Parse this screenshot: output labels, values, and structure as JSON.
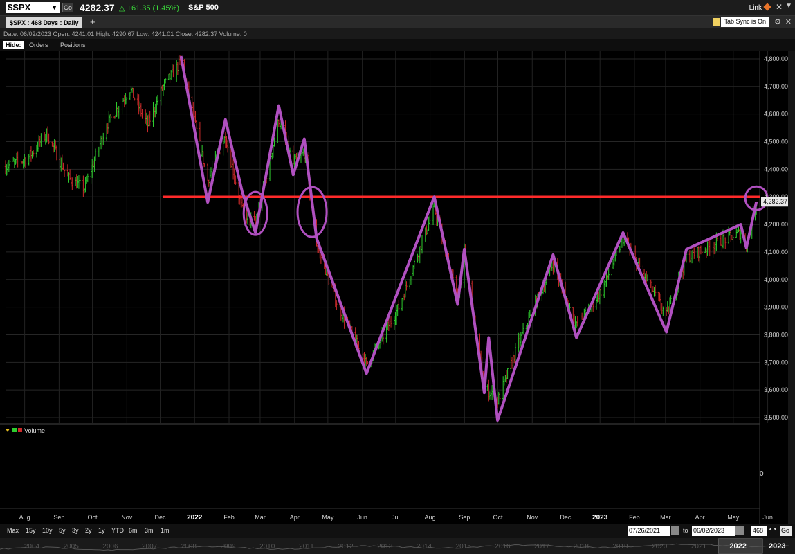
{
  "header": {
    "symbol": "$SPX",
    "go_label": "Go",
    "last_price": "4282.37",
    "change": "+61.35 (1.45%)",
    "index_name": "S&P 500",
    "link_label": "Link"
  },
  "tabs": {
    "active_tab": "$SPX : 468  Days : Daily",
    "tab_sync": "Tab Sync is On"
  },
  "info": {
    "text": "Date: 06/02/2023   Open: 4241.01   High: 4290.67   Low: 4241.01   Close: 4282.37   Volume: 0"
  },
  "subnav": {
    "hide_label": "Hide:",
    "orders_label": "Orders",
    "positions_label": "Positions"
  },
  "volume_panel": {
    "legend_label": "Volume",
    "zero_label": "0"
  },
  "timeframes": [
    "Max",
    "15y",
    "10y",
    "5y",
    "3y",
    "2y",
    "1y",
    "YTD",
    "6m",
    "3m",
    "1m"
  ],
  "date_range": {
    "from": "07/26/2021",
    "to_label": "to",
    "to": "06/02/2023",
    "days": "468",
    "go_label": "Go"
  },
  "navigator_years": [
    "2004",
    "2005",
    "2006",
    "2007",
    "2008",
    "2009",
    "2010",
    "2011",
    "2012",
    "2013",
    "2014",
    "2015",
    "2016",
    "2017",
    "2018",
    "2019",
    "2020",
    "2021",
    "2022",
    "2023"
  ],
  "colors": {
    "up": "#2ecc2e",
    "down": "#cc2a2a",
    "trendline": "#b050c0",
    "resistance": "#ff2a2a",
    "accent_link": "#e8742a"
  },
  "chart_data": {
    "type": "candlestick",
    "title": "",
    "y_ticks": [
      "3,500.00",
      "3,600.00",
      "3,700.00",
      "3,800.00",
      "3,900.00",
      "4,000.00",
      "4,100.00",
      "4,200.00",
      "4,300.00",
      "4,400.00",
      "4,500.00",
      "4,600.00",
      "4,700.00",
      "4,800.00"
    ],
    "ylim": [
      3480,
      4830
    ],
    "x_ticks": [
      "Aug",
      "Sep",
      "Oct",
      "Nov",
      "Dec",
      "2022",
      "Feb",
      "Mar",
      "Apr",
      "May",
      "Jun",
      "Jul",
      "Aug",
      "Sep",
      "Oct",
      "Nov",
      "Dec",
      "2023",
      "Feb",
      "Mar",
      "Apr",
      "May",
      "Jun"
    ],
    "last_value_label": "4,282.37",
    "resistance_level": 4300,
    "zigzag": [
      {
        "t": "2021-12-31",
        "v": 4810
      },
      {
        "t": "2022-01-24",
        "v": 4280
      },
      {
        "t": "2022-02-09",
        "v": 4580
      },
      {
        "t": "2022-02-24",
        "v": 4320
      },
      {
        "t": "2022-03-08",
        "v": 4170
      },
      {
        "t": "2022-03-29",
        "v": 4630
      },
      {
        "t": "2022-04-11",
        "v": 4380
      },
      {
        "t": "2022-04-21",
        "v": 4510
      },
      {
        "t": "2022-05-02",
        "v": 4150
      },
      {
        "t": "2022-06-16",
        "v": 3660
      },
      {
        "t": "2022-08-16",
        "v": 4300
      },
      {
        "t": "2022-09-06",
        "v": 3910
      },
      {
        "t": "2022-09-12",
        "v": 4110
      },
      {
        "t": "2022-09-30",
        "v": 3590
      },
      {
        "t": "2022-10-04",
        "v": 3790
      },
      {
        "t": "2022-10-12",
        "v": 3490
      },
      {
        "t": "2022-12-01",
        "v": 4090
      },
      {
        "t": "2022-12-22",
        "v": 3790
      },
      {
        "t": "2023-02-02",
        "v": 4170
      },
      {
        "t": "2023-03-13",
        "v": 3810
      },
      {
        "t": "2023-03-31",
        "v": 4110
      },
      {
        "t": "2023-05-19",
        "v": 4200
      },
      {
        "t": "2023-05-24",
        "v": 4115
      },
      {
        "t": "2023-06-02",
        "v": 4282
      }
    ],
    "circles": [
      {
        "t": "2022-03-08",
        "v": 4240
      },
      {
        "t": "2022-04-28",
        "v": 4245
      },
      {
        "t": "2023-06-02",
        "v": 4295
      }
    ],
    "series": [
      {
        "x": [
          "2021-07-26",
          "2021-08-15",
          "2021-09-01",
          "2021-09-20",
          "2021-10-05",
          "2021-10-25",
          "2021-11-15",
          "2021-12-01",
          "2021-12-15",
          "2021-12-31",
          "2022-01-24",
          "2022-02-09",
          "2022-02-24",
          "2022-03-08",
          "2022-03-29",
          "2022-04-11",
          "2022-04-21",
          "2022-05-02",
          "2022-05-20",
          "2022-06-16",
          "2022-07-15",
          "2022-08-16",
          "2022-09-06",
          "2022-09-12",
          "2022-09-30",
          "2022-10-12",
          "2022-11-01",
          "2022-12-01",
          "2022-12-22",
          "2023-01-15",
          "2023-02-02",
          "2023-03-13",
          "2023-03-31",
          "2023-05-01",
          "2023-05-19",
          "2023-05-24",
          "2023-06-02"
        ],
        "values": [
          4410,
          4440,
          4530,
          4370,
          4330,
          4560,
          4690,
          4560,
          4700,
          4790,
          4360,
          4520,
          4250,
          4200,
          4580,
          4420,
          4460,
          4130,
          3920,
          3690,
          3900,
          4260,
          3930,
          4090,
          3610,
          3560,
          3780,
          4060,
          3830,
          3970,
          4150,
          3870,
          4080,
          4140,
          4170,
          4130,
          4282
        ]
      }
    ]
  }
}
